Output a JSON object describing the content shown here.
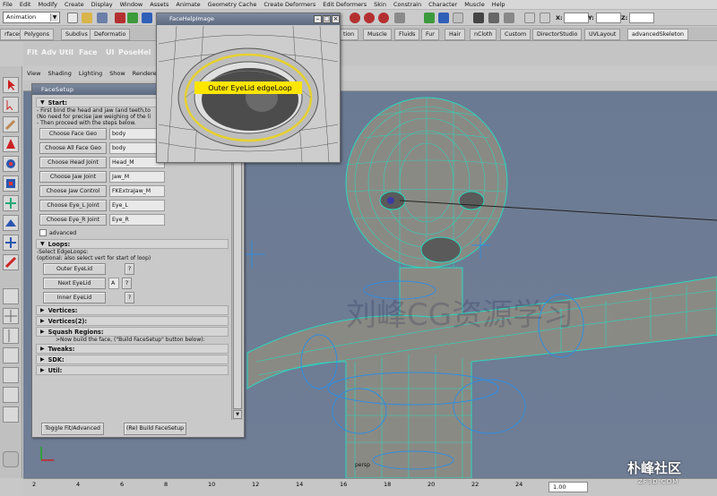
{
  "menubar": [
    "File",
    "Edit",
    "Modify",
    "Create",
    "Display",
    "Window",
    "Assets",
    "Animate",
    "Geometry Cache",
    "Create Deformers",
    "Edit Deformers",
    "Skin",
    "Constrain",
    "Character",
    "Muscle",
    "Help"
  ],
  "statusline": {
    "mode": "Animation",
    "coord_labels": [
      "X:",
      "Y:",
      "Z:"
    ]
  },
  "shelf_tabs": [
    "rfaces",
    "Polygons",
    "Subdivs",
    "Deformatio",
    "tion",
    "Muscle",
    "Fluids",
    "Fur",
    "Hair",
    "nCloth",
    "Custom",
    "DirectorStudio",
    "UVLayout",
    "advancedSkeleton"
  ],
  "shelf_active": "advancedSkeleton",
  "shelf_buttons": [
    "Fit",
    "Adv",
    "Util",
    "Face",
    "UI",
    "PoseHel"
  ],
  "viewport_menu": [
    "View",
    "Shading",
    "Lighting",
    "Show",
    "Renderer"
  ],
  "viewport_label": "persp",
  "facesetup": {
    "title": "FaceSetup",
    "start_header": "Start:",
    "start_notes": [
      "- First bind the head and jaw (and teeth,to",
      "  (No need for precise jaw weighing of the li",
      "- Then proceed with the steps below."
    ],
    "rows": [
      {
        "label": "Choose Face Geo",
        "value": "body"
      },
      {
        "label": "Choose All Face Geo",
        "value": "body"
      },
      {
        "label": "Choose Head Joint",
        "value": "Head_M"
      },
      {
        "label": "Choose Jaw Joint",
        "value": "Jaw_M"
      },
      {
        "label": "Choose Jaw Control",
        "value": "FKExtraJaw_M"
      },
      {
        "label": "Choose Eye_L Joint",
        "value": "Eye_L"
      },
      {
        "label": "Choose Eye_R Joint",
        "value": "Eye_R"
      }
    ],
    "advanced_label": "advanced",
    "loops_header": "Loops:",
    "loops_notes": [
      "-Select EdgeLoops:",
      "  (optional: also select vert for start of loop)"
    ],
    "outer_eyelid": "Outer EyeLid",
    "next_eyelid": "Next EyeLid",
    "next_value": "A",
    "inner_eyelid": "Inner EyeLid",
    "help_mark": "?",
    "collapsed": [
      "Vertices:",
      "Vertices(2):",
      "Squash Regions:"
    ],
    "build_note": ">Now build the face, (\"Build FaceSetup\" button below):",
    "collapsed2": [
      "Tweaks:",
      "SDK:",
      "Util:"
    ],
    "toggle_btn": "Toggle Fit/Advanced",
    "build_btn": "(Re) Build FaceSetup"
  },
  "helpimg": {
    "title": "FaceHelpImage",
    "callout": "Outer EyeLid edgeLoop"
  },
  "timeline": {
    "ticks": [
      "2",
      "4",
      "6",
      "8",
      "10",
      "12",
      "14",
      "16",
      "18",
      "20",
      "22",
      "24"
    ],
    "current_frame": "1.00"
  },
  "watermark": "朴峰社区",
  "watermark_sub": "ZF3D.COM",
  "overlay_text": "刘峰CG资源学习"
}
